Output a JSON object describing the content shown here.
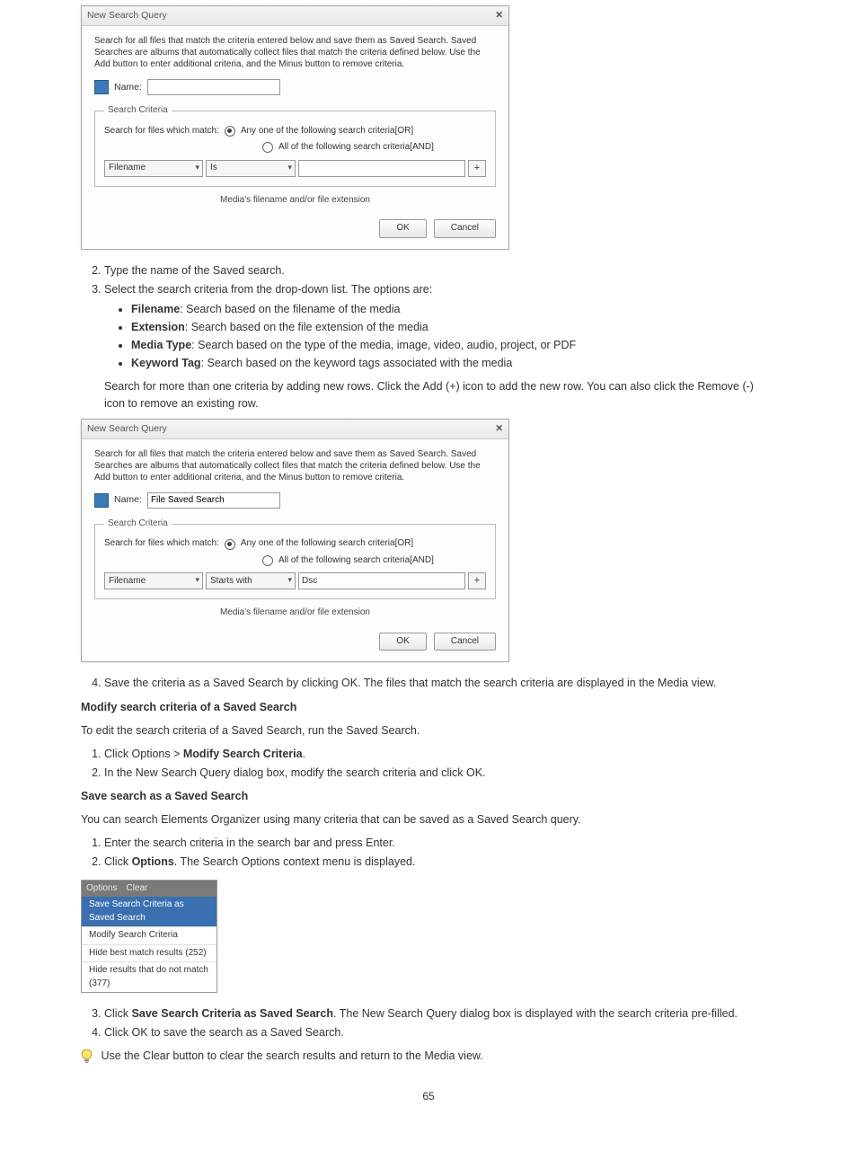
{
  "dialog1": {
    "title": "New Search Query",
    "desc": "Search for all files that match the criteria entered below and save them as Saved Search. Saved Searches are albums that automatically collect files that match the criteria defined below. Use the Add button to enter additional criteria, and the Minus button to remove criteria.",
    "name_label": "Name:",
    "name_value": "",
    "fieldset_legend": "Search Criteria",
    "match_label": "Search for files which match:",
    "opt_or": "Any one of the following search criteria[OR]",
    "opt_and": "All of the following search criteria[AND]",
    "crit_field": "Filename",
    "crit_op": "Is",
    "crit_val": "",
    "hint": "Media's filename and/or file extension",
    "btn_ok": "OK",
    "btn_cancel": "Cancel"
  },
  "dialog2": {
    "title": "New Search Query",
    "name_value": "File Saved Search",
    "crit_field": "Filename",
    "crit_op": "Starts with",
    "crit_val": "Dsc"
  },
  "text": {
    "step2": "Type the name of the Saved search.",
    "step3_intro": "Select the search criteria from the drop-down list. The options are:",
    "bullets": {
      "b1_a": "Filename",
      "b1_b": ": Search based on the filename of the media",
      "b2_a": "Extension",
      "b2_b": ": Search based on the file extension of the media",
      "b3_a": "Media Type",
      "b3_b": ": Search based on the type of the media, image, video, audio, project, or PDF",
      "b4_a": "Keyword Tag",
      "b4_b": ": Search based on the keyword tags associated with the media"
    },
    "step3_after": "Search for more than one criteria by adding new rows. Click the Add (+) icon to add the new row. You can also click the Remove (-) icon to remove an existing row.",
    "step4": "Save the criteria as a Saved Search by clicking OK. The files that match the search criteria are displayed in the Media view.",
    "mod_intro": "To edit the search criteria of a Saved Search, run the Saved Search.",
    "mod1_a": "Click Options >",
    "mod1_b": " Modify Search Criteria",
    "mod1_c": ".",
    "mod2": "In the New Search Query dialog box, modify the search criteria and click OK.",
    "save_intro": "You can search Elements Organizer using many criteria that can be saved as a Saved Search query.",
    "save1": "Enter the search criteria in the search bar and press Enter.",
    "save2_a": "Click",
    "save2_b": " Options",
    "save2_c": ". The Search Options context menu is displayed.",
    "save3_a": "Click",
    "save3_b": " Save Search Criteria as Saved Search",
    "save3_c": ". The New Search Query dialog box is displayed with the search criteria pre-filled.",
    "save4": "Click OK to save the search as a Saved Search.",
    "tip": "Use the Clear button to clear the search results and return to the Media view."
  },
  "headings": {
    "h_mod": "Modify search criteria of a Saved Search",
    "h_save": "Save search as a Saved Search"
  },
  "options_menu": {
    "hdr1": "Options",
    "hdr2": "Clear",
    "i1": "Save Search Criteria as Saved Search",
    "i2": "Modify Search Criteria",
    "i3": "Hide best match results (252)",
    "i4": "Hide results that do not match (377)"
  },
  "page_number": "65"
}
